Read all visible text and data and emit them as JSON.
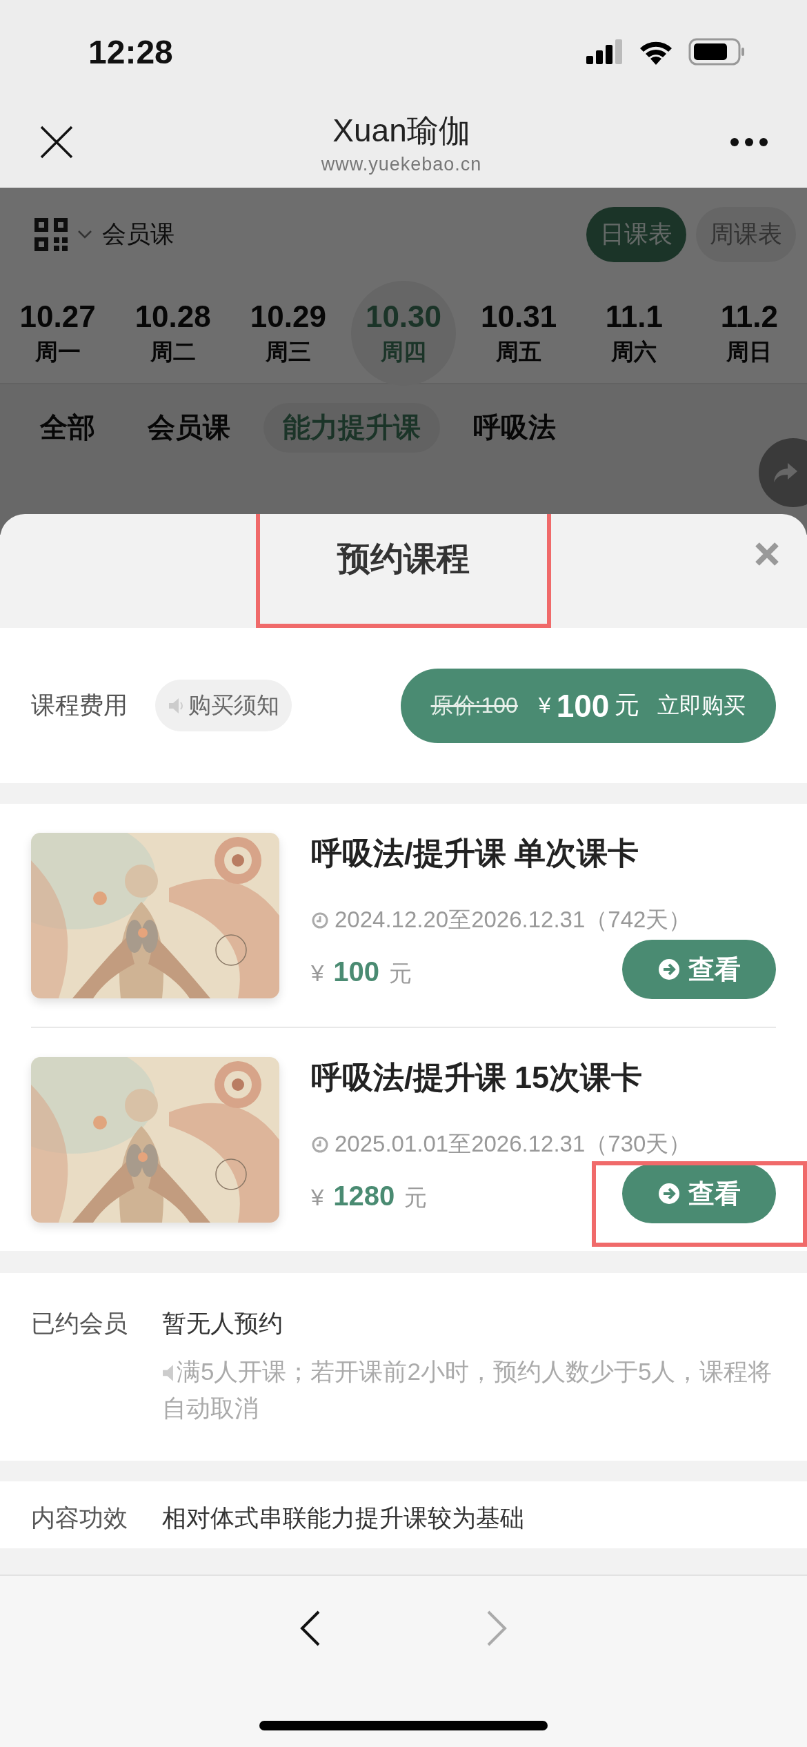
{
  "status_bar": {
    "time": "12:28"
  },
  "nav": {
    "title": "Xuan瑜伽",
    "subtitle": "www.yuekebao.cn"
  },
  "filter": {
    "course_type": "会员课",
    "views": [
      {
        "label": "日课表",
        "selected": true
      },
      {
        "label": "周课表",
        "selected": false
      }
    ]
  },
  "days": [
    {
      "date": "10.27",
      "weekday": "周一",
      "selected": false
    },
    {
      "date": "10.28",
      "weekday": "周二",
      "selected": false
    },
    {
      "date": "10.29",
      "weekday": "周三",
      "selected": false
    },
    {
      "date": "10.30",
      "weekday": "周四",
      "selected": true
    },
    {
      "date": "10.31",
      "weekday": "周五",
      "selected": false
    },
    {
      "date": "11.1",
      "weekday": "周六",
      "selected": false
    },
    {
      "date": "11.2",
      "weekday": "周日",
      "selected": false
    }
  ],
  "categories": [
    {
      "label": "全部",
      "selected": false
    },
    {
      "label": "会员课",
      "selected": false
    },
    {
      "label": "能力提升课",
      "selected": true
    },
    {
      "label": "呼吸法",
      "selected": false
    }
  ],
  "sheet": {
    "title": "预约课程",
    "title_highlighted": true,
    "fee": {
      "label": "课程费用",
      "notice": "购买须知",
      "original_price": "原价:100",
      "currency": "¥",
      "price": "100",
      "unit": "元",
      "action": "立即购买"
    },
    "cards": [
      {
        "title": "呼吸法/提升课 单次课卡",
        "validity": "2024.12.20至2026.12.31（742天）",
        "currency": "¥",
        "price": "100",
        "unit": "元",
        "button": "查看",
        "highlighted": false
      },
      {
        "title": "呼吸法/提升课 15次课卡",
        "validity": "2025.01.01至2026.12.31（730天）",
        "currency": "¥",
        "price": "1280",
        "unit": "元",
        "button": "查看",
        "highlighted": true
      }
    ],
    "booked": {
      "label": "已约会员",
      "value": "暂无人预约",
      "notice": "满5人开课；若开课前2小时，预约人数少于5人，课程将自动取消"
    },
    "content": {
      "label": "内容功效",
      "value": "相对体式串联能力提升课较为基础"
    }
  },
  "bottom_nav": {
    "back_disabled": false,
    "forward_disabled": true
  }
}
